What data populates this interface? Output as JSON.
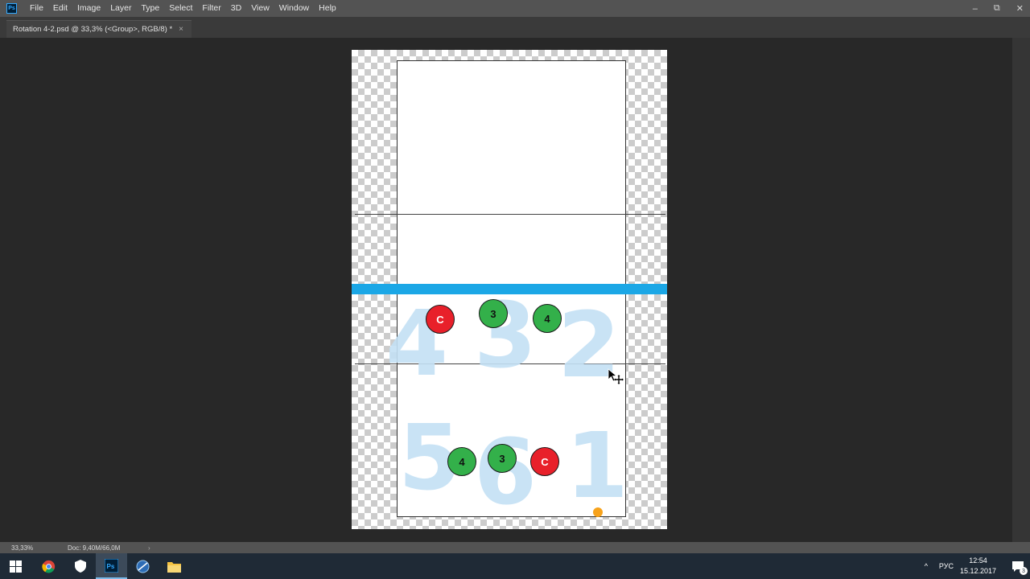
{
  "app": {
    "logo": "Ps"
  },
  "menu": [
    "File",
    "Edit",
    "Image",
    "Layer",
    "Type",
    "Select",
    "Filter",
    "3D",
    "View",
    "Window",
    "Help"
  ],
  "window_controls": {
    "minimize": "–",
    "restore": "⧉",
    "close": "✕"
  },
  "document_tab": {
    "title": "Rotation 4-2.psd @ 33,3% (<Group>, RGB/8) *",
    "close": "×"
  },
  "court": {
    "background_numbers": [
      "4",
      "3",
      "2",
      "5",
      "6",
      "1"
    ],
    "net_color": "#1ba7e6",
    "players": [
      {
        "label": "C",
        "color": "red"
      },
      {
        "label": "3",
        "color": "green"
      },
      {
        "label": "4",
        "color": "green"
      },
      {
        "label": "4",
        "color": "green"
      },
      {
        "label": "3",
        "color": "green"
      },
      {
        "label": "C",
        "color": "red"
      }
    ],
    "ball_color": "#f7a21b"
  },
  "status": {
    "zoom": "33,33%",
    "doc": "Doc: 9,40M/66,0M",
    "arrow": "›"
  },
  "taskbar": {
    "icons": [
      "windows-start-icon",
      "chrome-icon",
      "security-shield-icon",
      "photoshop-icon",
      "app-icon",
      "file-explorer-icon"
    ],
    "tray_arrow": "^",
    "language": "РУС",
    "time": "12:54",
    "date": "15.12.2017",
    "notifications": "3"
  }
}
